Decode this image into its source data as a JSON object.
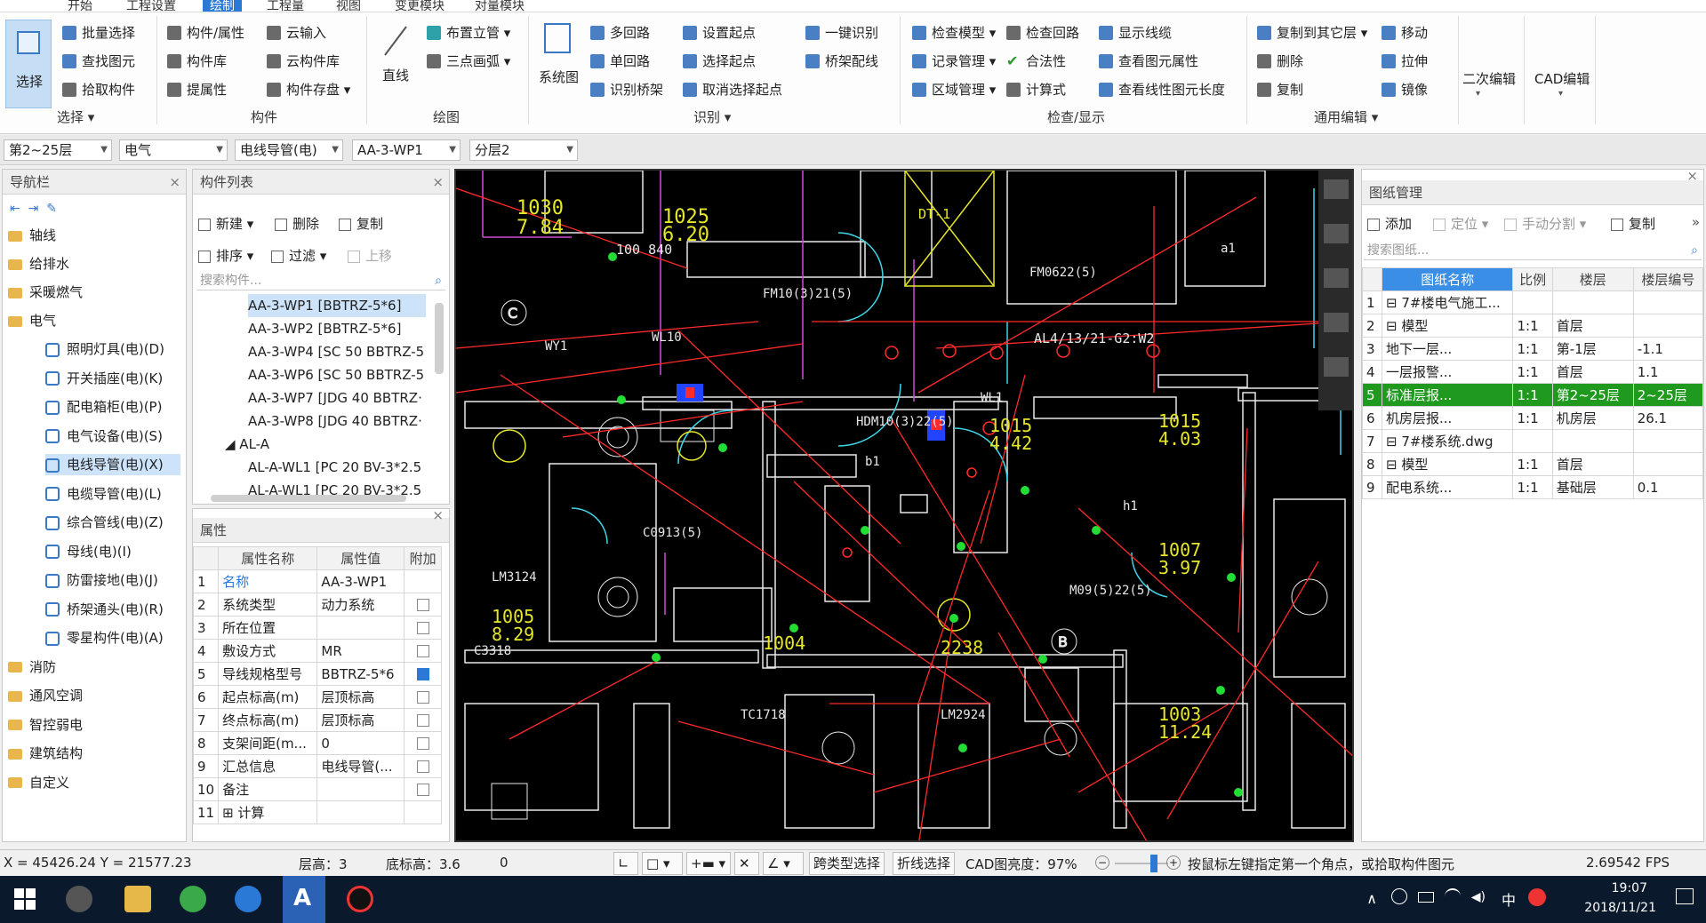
{
  "menu": {
    "items": [
      "开始",
      "工程设置",
      "绘制",
      "工程量",
      "视图",
      "变更模块",
      "对量模块"
    ],
    "active_index": 2
  },
  "ribbon": {
    "select": {
      "label": "选择",
      "group": "选择",
      "items": [
        "批量选择",
        "查找图元",
        "拾取构件"
      ]
    },
    "component": {
      "group": "构件",
      "items": [
        "构件/属性",
        "构件库",
        "提属性",
        "云输入",
        "云构件库",
        "构件存盘"
      ]
    },
    "draw": {
      "group": "绘图",
      "line": "直线",
      "items": [
        "布置立管",
        "三点画弧"
      ]
    },
    "identify": {
      "group": "识别",
      "system": "系统图",
      "items": [
        "多回路",
        "单回路",
        "识别桥架",
        "设置起点",
        "选择起点",
        "取消选择起点",
        "一键识别",
        "桥架配线"
      ]
    },
    "check": {
      "group": "检查/显示",
      "items": [
        "检查模型",
        "记录管理",
        "区域管理",
        "检查回路",
        "合法性",
        "计算式",
        "显示线缆",
        "查看图元属性",
        "查看线性图元长度"
      ]
    },
    "edit": {
      "group": "通用编辑",
      "items": [
        "复制到其它层",
        "删除",
        "复制",
        "移动",
        "拉伸",
        "镜像"
      ]
    },
    "second_edit": "二次编辑",
    "cad_edit": "CAD编辑"
  },
  "dropdowns": [
    "第2~25层",
    "电气",
    "电线导管(电)",
    "AA-3-WP1",
    "分层2"
  ],
  "nav": {
    "title": "导航栏",
    "folders_top": [
      "轴线",
      "给排水",
      "采暖燃气",
      "电气"
    ],
    "electric": [
      "照明灯具(电)(D)",
      "开关插座(电)(K)",
      "配电箱柜(电)(P)",
      "电气设备(电)(S)",
      "电线导管(电)(X)",
      "电缆导管(电)(L)",
      "综合管线(电)(Z)",
      "母线(电)(I)",
      "防雷接地(电)(J)",
      "桥架通头(电)(R)",
      "零星构件(电)(A)"
    ],
    "selected_index": 4,
    "folders_bottom": [
      "消防",
      "通风空调",
      "智控弱电",
      "建筑结构",
      "自定义"
    ]
  },
  "component_list": {
    "title": "构件列表",
    "toolbar": [
      "新建",
      "删除",
      "复制",
      "排序",
      "过滤",
      "上移"
    ],
    "search_placeholder": "搜索构件...",
    "items": [
      "AA-3-WP1 [BBTRZ-5*6]",
      "AA-3-WP2 [BBTRZ-5*6]",
      "AA-3-WP4 [SC 50 BBTRZ-5",
      "AA-3-WP6 [SC 50 BBTRZ-5",
      "AA-3-WP7 [JDG 40 BBTRZ·",
      "AA-3-WP8 [JDG 40 BBTRZ·"
    ],
    "group": "AL-A",
    "group_items": [
      "AL-A-WL1 [PC 20 BV-3*2.5",
      "AL-A-WL1 [PC 20 BV-3*2.5"
    ]
  },
  "properties": {
    "title": "属性",
    "headers": [
      "属性名称",
      "属性值",
      "附加"
    ],
    "rows": [
      {
        "n": "1",
        "name": "名称",
        "value": "AA-3-WP1",
        "check": null
      },
      {
        "n": "2",
        "name": "系统类型",
        "value": "动力系统",
        "check": false
      },
      {
        "n": "3",
        "name": "所在位置",
        "value": "",
        "check": false
      },
      {
        "n": "4",
        "name": "敷设方式",
        "value": "MR",
        "check": false
      },
      {
        "n": "5",
        "name": "导线规格型号",
        "value": "BBTRZ-5*6",
        "check": true
      },
      {
        "n": "6",
        "name": "起点标高(m)",
        "value": "层顶标高",
        "check": false
      },
      {
        "n": "7",
        "name": "终点标高(m)",
        "value": "层顶标高",
        "check": false
      },
      {
        "n": "8",
        "name": "支架间距(m...",
        "value": "0",
        "check": false
      },
      {
        "n": "9",
        "name": "汇总信息",
        "value": "电线导管(...",
        "check": false
      },
      {
        "n": "10",
        "name": "备注",
        "value": "",
        "check": false
      },
      {
        "n": "11",
        "name": "⊞ 计算",
        "value": "",
        "check": null
      }
    ]
  },
  "drawings": {
    "title": "图纸管理",
    "toolbar": [
      "添加",
      "定位",
      "手动分割",
      "复制"
    ],
    "search_placeholder": "搜索图纸...",
    "headers": [
      "图纸名称",
      "比例",
      "楼层",
      "楼层编号"
    ],
    "rows": [
      {
        "n": "1",
        "name": "⊟ 7#楼电气施工...",
        "scale": "",
        "floor": "",
        "code": ""
      },
      {
        "n": "2",
        "name": "⊟ 模型",
        "scale": "1:1",
        "floor": "首层",
        "code": ""
      },
      {
        "n": "3",
        "name": "地下一层...",
        "scale": "1:1",
        "floor": "第-1层",
        "code": "-1.1"
      },
      {
        "n": "4",
        "name": "一层报警...",
        "scale": "1:1",
        "floor": "首层",
        "code": "1.1"
      },
      {
        "n": "5",
        "name": "标准层报...",
        "scale": "1:1",
        "floor": "第2~25层",
        "code": "2~25层"
      },
      {
        "n": "6",
        "name": "机房层报...",
        "scale": "1:1",
        "floor": "机房层",
        "code": "26.1"
      },
      {
        "n": "7",
        "name": "⊟ 7#楼系统.dwg",
        "scale": "",
        "floor": "",
        "code": ""
      },
      {
        "n": "8",
        "name": "⊟ 模型",
        "scale": "1:1",
        "floor": "首层",
        "code": ""
      },
      {
        "n": "9",
        "name": "配电系统...",
        "scale": "1:1",
        "floor": "基础层",
        "code": "0.1"
      }
    ],
    "selected_index": 4
  },
  "cad_labels": [
    "1030",
    "7.84",
    "1025",
    "6.20",
    "100 840",
    "DT-1",
    "FM10(3)21(5)",
    "FM0622(5)",
    "WL10",
    "WL1",
    "AL4/13/21-G2:W2",
    "HDM10(3)22(5)",
    "1015",
    "4.42",
    "1015",
    "4.03",
    "C0913(5)",
    "LM3124",
    "1005",
    "8.29",
    "C3318",
    "1004",
    "2238",
    "1007",
    "3.97",
    "M09(5)22(5)",
    "TC1718",
    "LM2924",
    "1003",
    "11.24",
    "WY1",
    "a1",
    "b1",
    "h1"
  ],
  "status": {
    "coords": "X = 45426.24 Y = 21577.23",
    "floor_height": "层高：3",
    "base_height": "底标高：3.6",
    "zero": "0",
    "btn_type_select": "跨类型选择",
    "btn_polyline": "折线选择",
    "cad_brightness": "CAD图亮度：97%",
    "hint": "按鼠标左键指定第一个角点，或拾取构件图元",
    "fps": "2.69542 FPS"
  },
  "taskbar": {
    "time": "19:07",
    "date": "2018/11/21",
    "ime": "中"
  },
  "colors": {
    "accent": "#2b79d6",
    "selected_row": "#1f9a1f",
    "canvas_bg": "#000000",
    "cad_red": "#ff2a2a",
    "cad_white": "#e8e8e8",
    "cad_cyan": "#3fd7e8",
    "cad_magenta": "#d04ad8",
    "cad_yellow": "#e6e62a",
    "cad_green": "#22dd33"
  }
}
